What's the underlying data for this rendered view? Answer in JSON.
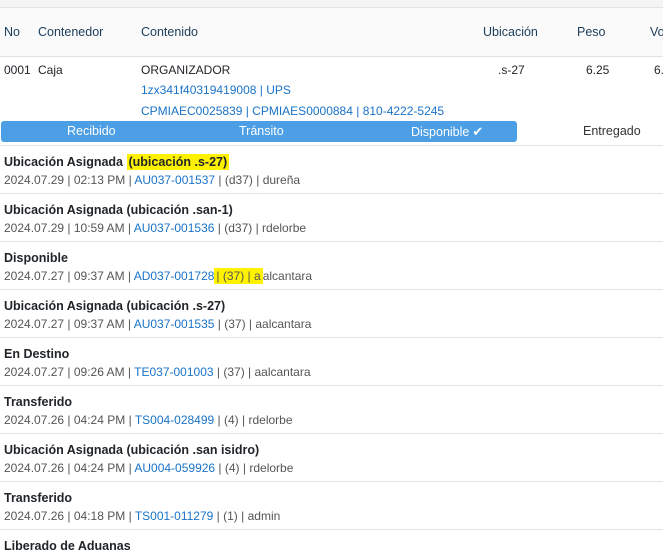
{
  "table": {
    "headers": [
      "No",
      "Contenedor",
      "Contenido",
      "Ubicación",
      "Peso",
      "Vo"
    ],
    "row": {
      "no": "0001",
      "contenedor": "Caja",
      "contenido": "ORGANIZADOR",
      "tracking_line": "1zx341f40319419008 | UPS",
      "refs_line": "CPMIAEC0025839 | CPMIAES0000884 | 810-4222-5245",
      "ubicacion": ".s-27",
      "peso": "6.25",
      "vol": "6."
    }
  },
  "statusbar": {
    "stages": [
      "Recibido",
      "Tránsito",
      "Disponible",
      "Entregado"
    ],
    "current_stage": "Disponible",
    "check_icon": "✔",
    "progress_color": "#4d9fe5"
  },
  "history": [
    {
      "title": "Ubicación Asignada",
      "detail": "(ubicación .s-27)",
      "date": "2024.07.29",
      "time": "02:13 PM",
      "doc": "AU037-001537",
      "code": "(d37)",
      "user": "dureña"
    },
    {
      "title": "Ubicación Asignada",
      "detail": "(ubicación .san-1)",
      "date": "2024.07.29",
      "time": "10:59 AM",
      "doc": "AU037-001536",
      "code": "(d37)",
      "user": "rdelorbe"
    },
    {
      "title": "Disponible",
      "detail": "",
      "date": "2024.07.27",
      "time": "09:37 AM",
      "doc": "AD037-001728",
      "code": "(37)",
      "user": "aalcantara"
    },
    {
      "title": "Ubicación Asignada",
      "detail": "(ubicación .s-27)",
      "date": "2024.07.27",
      "time": "09:37 AM",
      "doc": "AU037-001535",
      "code": "(37)",
      "user": "aalcantara"
    },
    {
      "title": "En Destino",
      "detail": "",
      "date": "2024.07.27",
      "time": "09:26 AM",
      "doc": "TE037-001003",
      "code": "(37)",
      "user": "aalcantara"
    },
    {
      "title": "Transferido",
      "detail": "",
      "date": "2024.07.26",
      "time": "04:24 PM",
      "doc": "TS004-028499",
      "code": "(4)",
      "user": "rdelorbe"
    },
    {
      "title": "Ubicación Asignada",
      "detail": "(ubicación .san isidro)",
      "date": "2024.07.26",
      "time": "04:24 PM",
      "doc": "AU004-059926",
      "code": "(4)",
      "user": "rdelorbe"
    },
    {
      "title": "Transferido",
      "detail": "",
      "date": "2024.07.26",
      "time": "04:18 PM",
      "doc": "TS001-011279",
      "code": "(1)",
      "user": "admin"
    },
    {
      "title": "Liberado de Aduanas",
      "detail": "",
      "date": "",
      "time": "",
      "doc": "",
      "code": "",
      "user": ""
    }
  ],
  "highlight_color": "#fff200"
}
